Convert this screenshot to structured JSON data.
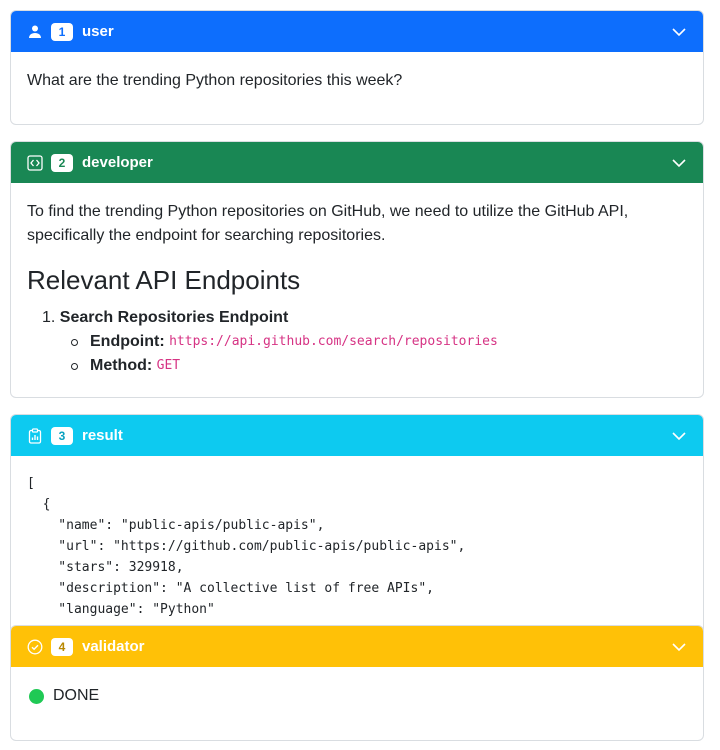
{
  "colors": {
    "user": "#0d6efd",
    "developer": "#198754",
    "result": "#0dcaf0",
    "validator": "#ffc107",
    "done_dot": "#20c955"
  },
  "messages": [
    {
      "index": "1",
      "role": "user",
      "icon": "person-icon",
      "text": "What are the trending Python repositories this week?"
    },
    {
      "index": "2",
      "role": "developer",
      "icon": "code-icon",
      "intro": "To find the trending Python repositories on GitHub, we need to utilize the GitHub API, specifically the endpoint for searching repositories.",
      "heading": "Relevant API Endpoints",
      "list_number": "1.",
      "list_item_title": "Search Repositories Endpoint",
      "endpoint_label": "Endpoint:",
      "endpoint_value": "https://api.github.com/search/repositories",
      "method_label": "Method:",
      "method_value": "GET"
    },
    {
      "index": "3",
      "role": "result",
      "icon": "clipboard-data-icon",
      "code_lines": [
        "[",
        "  {",
        "    \"name\": \"public-apis/public-apis\",",
        "    \"url\": \"https://github.com/public-apis/public-apis\",",
        "    \"stars\": 329918,",
        "    \"description\": \"A collective list of free APIs\",",
        "    \"language\": \"Python\""
      ]
    },
    {
      "index": "4",
      "role": "validator",
      "icon": "check-circle-icon",
      "status": "DONE"
    }
  ]
}
